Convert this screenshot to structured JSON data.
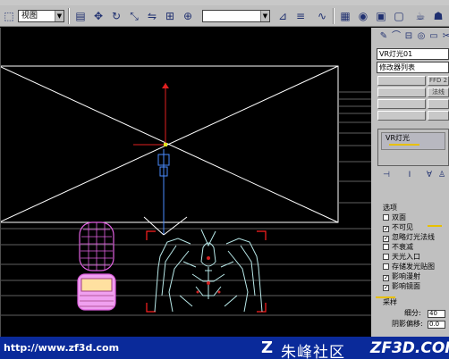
{
  "menubar": {
    "items": [
      "",
      "",
      "",
      "",
      "",
      "",
      "",
      "",
      "",
      ""
    ]
  },
  "toolbar": {
    "view_dropdown": "视图",
    "selection_dropdown": "",
    "icons": [
      "select-icon",
      "select-by-name-icon",
      "rect-region-icon",
      "move-icon",
      "rotate-icon",
      "scale-icon",
      "mirror-icon",
      "align-icon",
      "layer-icon",
      "curve-editor-icon",
      "schematic-icon",
      "material-editor-icon",
      "render-scene-icon",
      "quick-render-icon"
    ]
  },
  "panel": {
    "tabs": [
      "create-tab",
      "modify-tab",
      "hierarchy-tab",
      "motion-tab",
      "display-tab",
      "utilities-tab"
    ],
    "object_name": "VR灯光01",
    "modifier_list": "修改器列表",
    "mod_buttons": [
      "",
      "FFD 2",
      "",
      "法线",
      "",
      "",
      "",
      "",
      "",
      ""
    ],
    "stack_item": "VR灯光",
    "options_title": "选项",
    "options": [
      {
        "label": "双面",
        "checked": false
      },
      {
        "label": "不可见",
        "checked": true
      },
      {
        "label": "忽略灯光法线",
        "checked": true
      },
      {
        "label": "不衰减",
        "checked": false
      },
      {
        "label": "天光入口",
        "checked": false
      },
      {
        "label": "存储发光贴图",
        "checked": false
      },
      {
        "label": "影响漫射",
        "checked": true
      },
      {
        "label": "影响镜面",
        "checked": true
      }
    ],
    "sampling_title": "采样",
    "subdivs_label": "细分:",
    "subdivs_value": "40",
    "shadow_bias_label": "阴影偏移:",
    "shadow_bias_value": "0.0"
  },
  "banner": {
    "url": "http://www.zf3d.com",
    "logo_mark": "Z",
    "chinese_name": "朱峰社区",
    "site": "ZF3D.COM"
  },
  "colors": {
    "viewport_bg": "#000000",
    "panel_bg": "#c0c0c0",
    "banner_bg": "#0a2a9a",
    "light_gizmo": "#ffffff",
    "axis_y": "#e02020",
    "target_line": "#4a8cff",
    "robot_color": "#b8e8e8",
    "capsule_color": "#e060e0",
    "selection_bracket": "#ff2020",
    "accent_yellow": "#e8c000"
  }
}
